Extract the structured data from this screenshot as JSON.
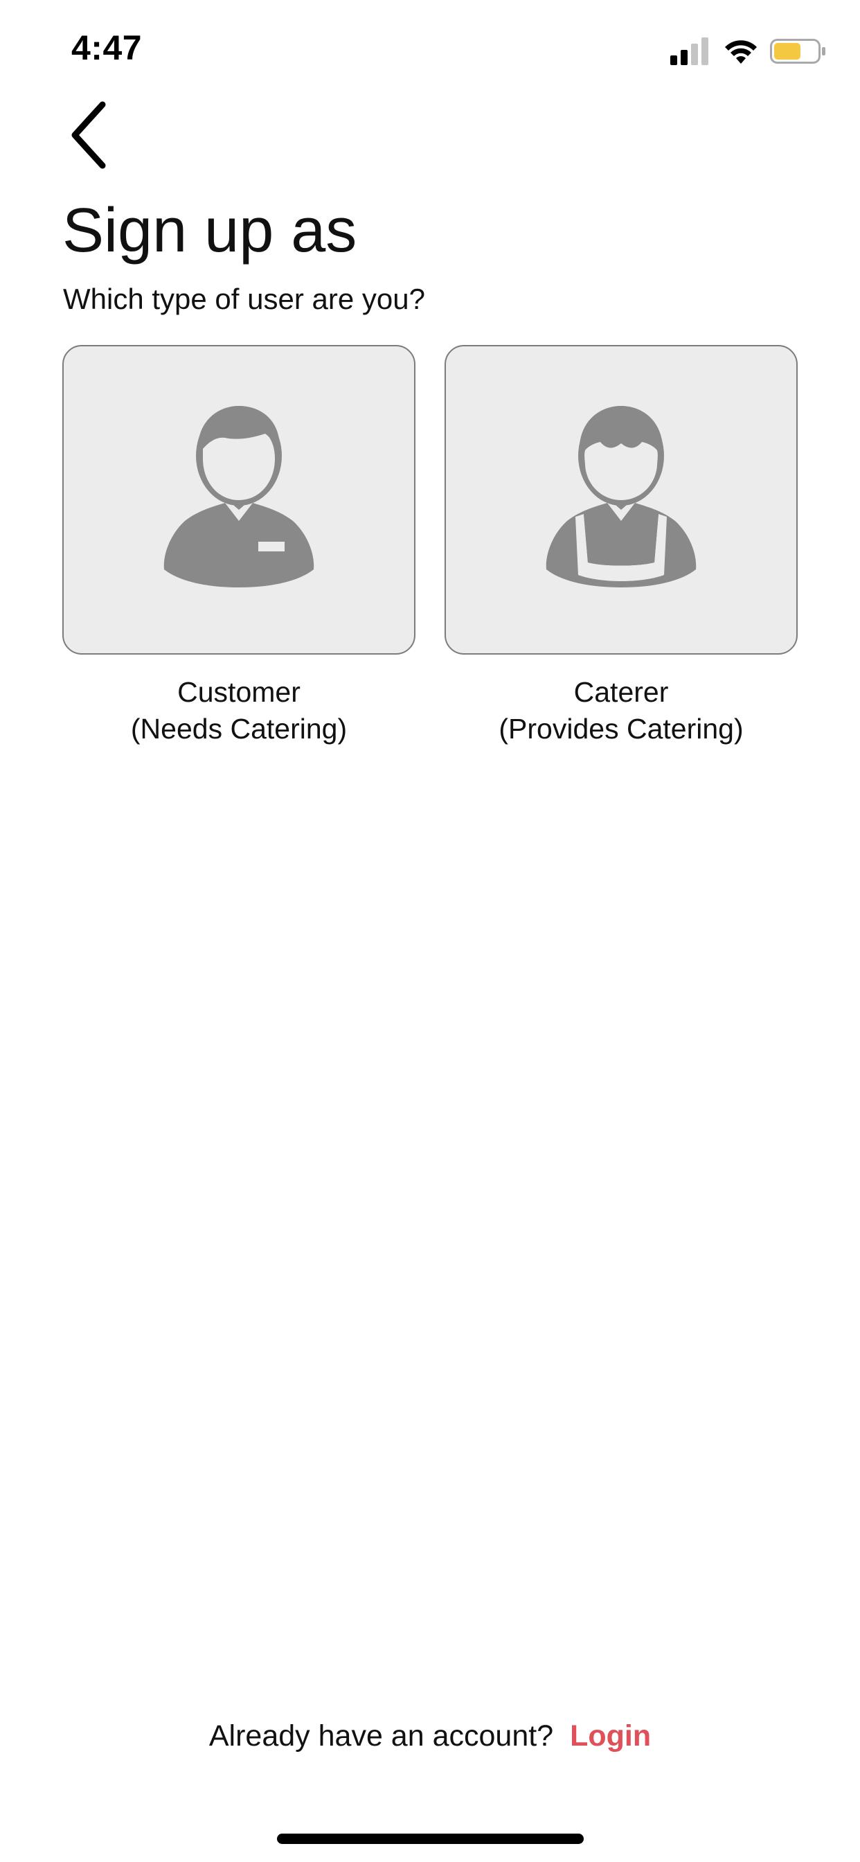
{
  "status_bar": {
    "time": "4:47",
    "icons": [
      "cellular-signal-icon",
      "wifi-icon",
      "battery-icon"
    ],
    "battery_color": "#f5c842"
  },
  "header": {
    "back_icon": "chevron-left-icon",
    "title": "Sign up as",
    "subtitle": "Which type of user are you?"
  },
  "options": [
    {
      "id": "customer",
      "icon": "customer-person-icon",
      "label_line1": "Customer",
      "label_line2": "(Needs Catering)"
    },
    {
      "id": "caterer",
      "icon": "caterer-person-apron-icon",
      "label_line1": "Caterer",
      "label_line2": "(Provides Catering)"
    }
  ],
  "footer": {
    "prompt": "Already have an account?",
    "login_label": "Login"
  },
  "colors": {
    "accent": "#e0505a",
    "card_background": "#ececec",
    "card_border": "#7c7c7c",
    "icon_gray": "#898989"
  }
}
